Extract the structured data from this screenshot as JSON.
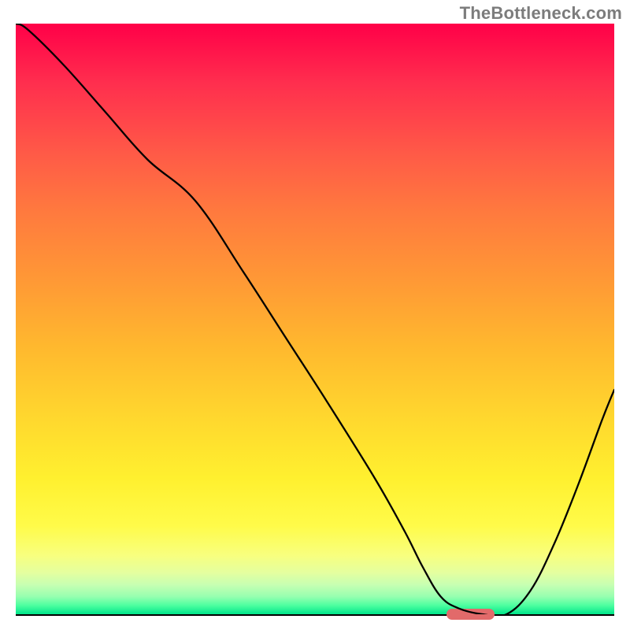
{
  "watermark": "TheBottleneck.com",
  "chart_data": {
    "type": "line",
    "title": "",
    "xlabel": "",
    "ylabel": "",
    "xlim": [
      0,
      100
    ],
    "ylim": [
      0,
      100
    ],
    "x": [
      0,
      2,
      8,
      15,
      22,
      30,
      38,
      45,
      52,
      60,
      65,
      68,
      71,
      74,
      78,
      82,
      86,
      90,
      94,
      98,
      100
    ],
    "values": [
      100,
      99,
      93,
      85,
      77,
      70,
      58,
      47,
      36,
      23,
      14,
      8,
      3,
      1,
      0,
      0,
      4,
      12,
      22,
      33,
      38
    ],
    "marker": {
      "x_start": 72,
      "x_end": 80,
      "y": 0
    },
    "background_gradient": {
      "top_color": "#ff0048",
      "mid_color": "#ffd82e",
      "bottom_color": "#00e58a"
    }
  }
}
